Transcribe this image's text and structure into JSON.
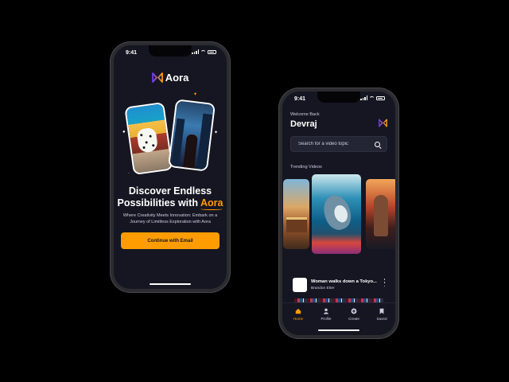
{
  "colors": {
    "accent": "#ff9c01",
    "background": "#161622",
    "surface": "#232533",
    "muted_text": "#cdcde0",
    "brand_gradient_start": "#6b3cf0",
    "brand_gradient_end": "#ff9c01"
  },
  "onboarding": {
    "status_time": "9:41",
    "app_name": "Aora",
    "headline_line1": "Discover Endless",
    "headline_line2_prefix": "Possibilities with ",
    "headline_brand": "Aora",
    "subtitle": "Where Creativity Meets Innovation: Embark on a Journey of Limitless Exploration with Aora",
    "cta_label": "Continue with Email",
    "icons": [
      "aora-logo-icon",
      "sparkle-icon"
    ]
  },
  "home": {
    "status_time": "9:41",
    "welcome_label": "Welcome Back",
    "user_name": "Devraj",
    "search": {
      "placeholder": "Search for a video topic",
      "icon": "search-icon"
    },
    "trending_title": "Trending Videos",
    "latest_video": {
      "title": "Woman walks down a Tokyo...",
      "author": "Brandon Etter"
    },
    "tabs": [
      {
        "label": "Home",
        "icon": "home-icon",
        "active": true
      },
      {
        "label": "Profile",
        "icon": "profile-icon",
        "active": false
      },
      {
        "label": "Create",
        "icon": "plus-circle-icon",
        "active": false
      },
      {
        "label": "Saved",
        "icon": "bookmark-icon",
        "active": false
      }
    ]
  }
}
